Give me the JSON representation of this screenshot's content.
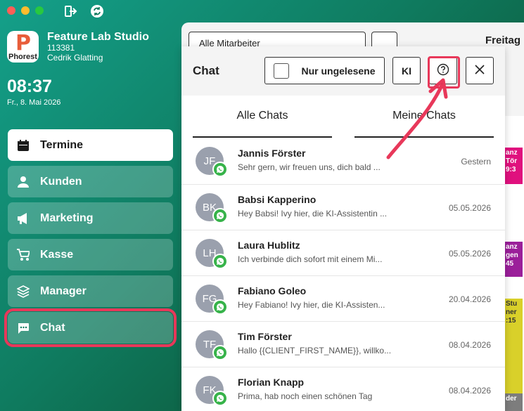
{
  "window": {
    "traffic_lights": [
      "close",
      "minimize",
      "zoom"
    ],
    "toolbar_icons": [
      "logout-icon",
      "sync-icon"
    ]
  },
  "brand": {
    "logo_word": "Phorest",
    "name": "Feature Lab Studio",
    "id": "113381",
    "user": "Cedrik Glatting"
  },
  "clock": {
    "time": "08:37",
    "date": "Fr., 8. Mai 2026"
  },
  "sidebar": {
    "items": [
      {
        "label": "Termine",
        "icon": "calendar-icon",
        "active": true
      },
      {
        "label": "Kunden",
        "icon": "person-icon"
      },
      {
        "label": "Marketing",
        "icon": "megaphone-icon"
      },
      {
        "label": "Kasse",
        "icon": "cart-icon"
      },
      {
        "label": "Manager",
        "icon": "layers-icon"
      },
      {
        "label": "Chat",
        "icon": "chat-icon",
        "highlighted": true
      }
    ]
  },
  "background": {
    "employee_select": "Alle Mitarbeiter",
    "day_label": "Freitag",
    "appointments": [
      {
        "text": "anz Tör 9:3",
        "color": "#e0117e"
      },
      {
        "text": "anz gen 45",
        "color": "#9b1f9a"
      },
      {
        "text": "Stu ner :15",
        "color": "#d9d02a"
      },
      {
        "text": "der",
        "color": "#7d7d7d"
      }
    ]
  },
  "chat": {
    "title": "Chat",
    "unread_label": "Nur ungelesene",
    "ki_label": "KI",
    "tabs": [
      "Alle Chats",
      "Meine Chats"
    ],
    "conversations": [
      {
        "initials": "JF",
        "name": "Jannis Förster",
        "message": "Sehr gern, wir freuen uns, dich bald ...",
        "date": "Gestern"
      },
      {
        "initials": "BK",
        "name": "Babsi Kapperino",
        "message": "Hey Babsi! Ivy hier, die KI-Assistentin ...",
        "date": "05.05.2026"
      },
      {
        "initials": "LH",
        "name": "Laura Hublitz",
        "message": "Ich verbinde dich sofort mit einem Mi...",
        "date": "05.05.2026"
      },
      {
        "initials": "FG",
        "name": "Fabiano Goleo",
        "message": "Hey Fabiano! Ivy hier, die KI-Assisten...",
        "date": "20.04.2026"
      },
      {
        "initials": "TF",
        "name": "Tim Förster",
        "message": "Hallo {{CLIENT_FIRST_NAME}}, willko...",
        "date": "08.04.2026"
      },
      {
        "initials": "FK",
        "name": "Florian Knapp",
        "message": "Prima, hab noch einen schönen Tag",
        "date": "08.04.2026"
      }
    ]
  },
  "colors": {
    "accent_highlight": "#e8385a",
    "whatsapp": "#37b34a",
    "avatar": "#9aa0ad"
  }
}
